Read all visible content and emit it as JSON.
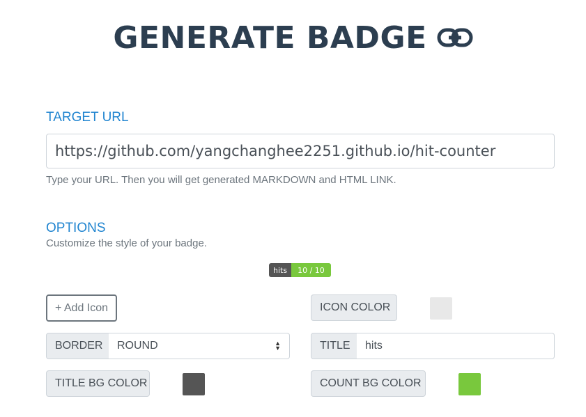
{
  "header": {
    "title": "GENERATE BADGE"
  },
  "icons": {
    "title_icon": "link-icon"
  },
  "target": {
    "label": "TARGET URL",
    "url_value": "https://github.com/yangchanghee2251.github.io/hit-counter",
    "help": "Type your URL. Then you will get generated MARKDOWN and HTML LINK."
  },
  "options": {
    "label": "OPTIONS",
    "help": "Customize the style of your badge.",
    "badge": {
      "title": "hits",
      "count": "10 / 10"
    },
    "add_icon_label": "+ Add Icon",
    "icon_color_label": "ICON COLOR",
    "border_label": "BORDER",
    "border_value": "ROUND",
    "title_label": "TITLE",
    "title_value": "hits",
    "title_bg_label": "TITLE BG COLOR",
    "count_bg_label": "COUNT BG COLOR"
  },
  "colors": {
    "accent": "#2185d0",
    "heading": "#2c3e50",
    "icon_color": "#e8e8e8",
    "title_bg": "#555555",
    "count_bg": "#79c83d"
  }
}
